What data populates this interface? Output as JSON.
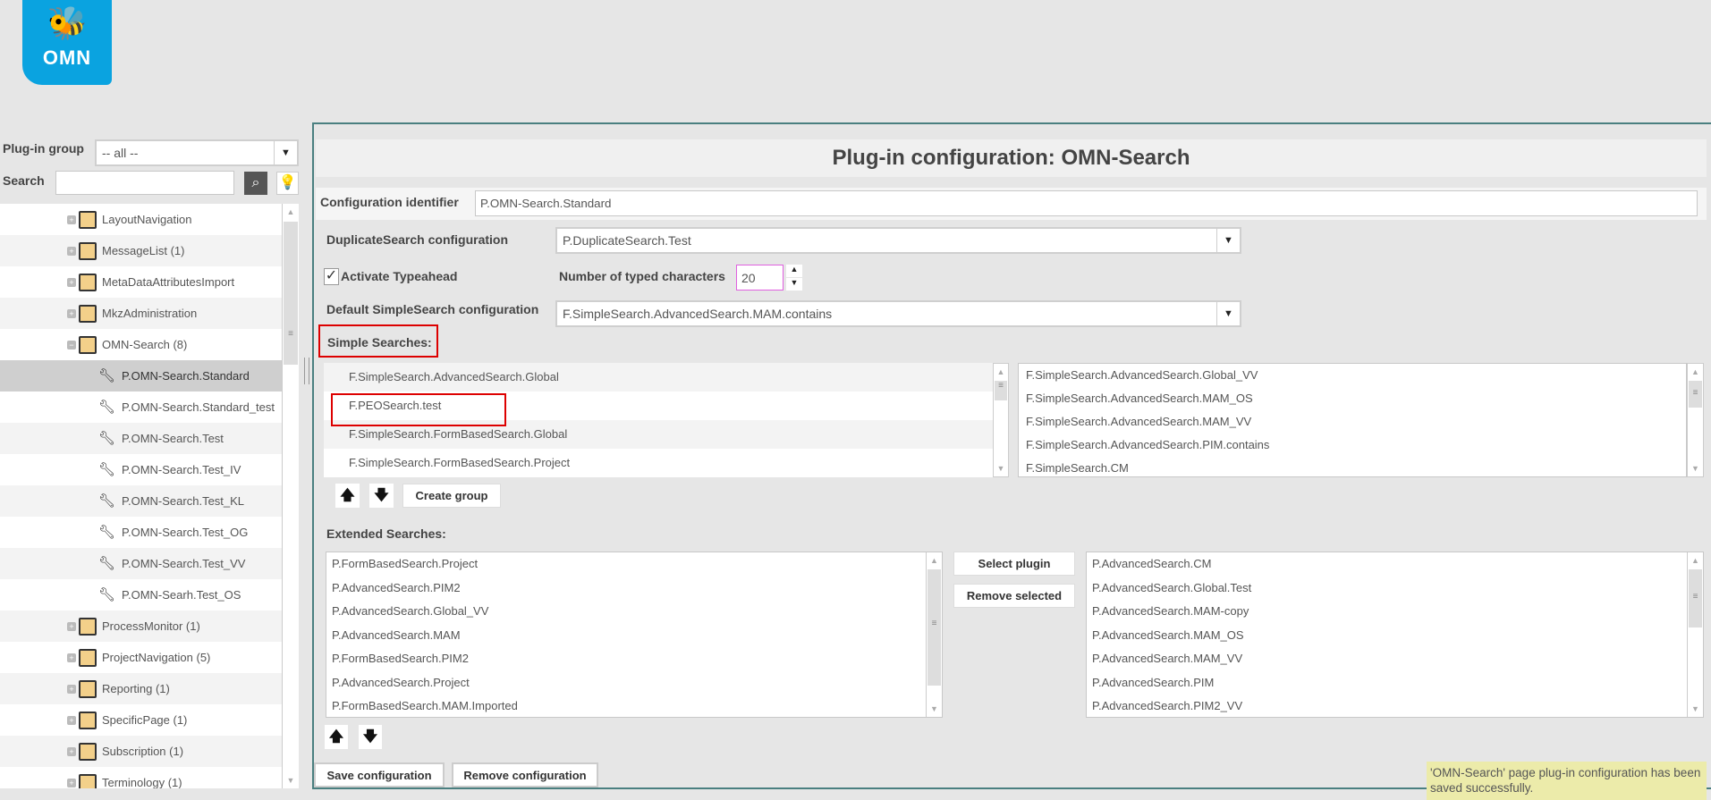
{
  "logo": {
    "text": "OMN"
  },
  "sidebar": {
    "plugin_group_label": "Plug-in group",
    "plugin_group_value": "-- all --",
    "search_label": "Search",
    "search_value": "",
    "tree": [
      {
        "label": "LayoutNavigation",
        "type": "group"
      },
      {
        "label": "MessageList (1)",
        "type": "group"
      },
      {
        "label": "MetaDataAttributesImport",
        "type": "group"
      },
      {
        "label": "MkzAdministration",
        "type": "group"
      },
      {
        "label": "OMN-Search (8)",
        "type": "group",
        "expanded": true
      },
      {
        "label": "P.OMN-Search.Standard",
        "type": "child",
        "selected": true
      },
      {
        "label": "P.OMN-Search.Standard_test",
        "type": "child"
      },
      {
        "label": "P.OMN-Search.Test",
        "type": "child"
      },
      {
        "label": "P.OMN-Search.Test_IV",
        "type": "child"
      },
      {
        "label": "P.OMN-Search.Test_KL",
        "type": "child"
      },
      {
        "label": "P.OMN-Search.Test_OG",
        "type": "child"
      },
      {
        "label": "P.OMN-Search.Test_VV",
        "type": "child"
      },
      {
        "label": "P.OMN-Searh.Test_OS",
        "type": "child"
      },
      {
        "label": "ProcessMonitor (1)",
        "type": "group"
      },
      {
        "label": "ProjectNavigation (5)",
        "type": "group"
      },
      {
        "label": "Reporting (1)",
        "type": "group"
      },
      {
        "label": "SpecificPage (1)",
        "type": "group"
      },
      {
        "label": "Subscription (1)",
        "type": "group"
      },
      {
        "label": "Terminology (1)",
        "type": "group"
      }
    ]
  },
  "main": {
    "title": "Plug-in configuration: OMN-Search",
    "config_id_label": "Configuration identifier",
    "config_id_value": "P.OMN-Search.Standard",
    "duplicate_label": "DuplicateSearch configuration",
    "duplicate_value": "P.DuplicateSearch.Test",
    "typeahead_label": "Activate Typeahead",
    "typeahead_checked": true,
    "typed_chars_label": "Number of typed characters",
    "typed_chars_value": "20",
    "default_simple_label": "Default SimpleSearch configuration",
    "default_simple_value": "F.SimpleSearch.AdvancedSearch.MAM.contains",
    "simple_label": "Simple Searches:",
    "simple_selected": [
      "F.SimpleSearch.AdvancedSearch.Global",
      "F.PEOSearch.test",
      "F.SimpleSearch.FormBasedSearch.Global",
      "F.SimpleSearch.FormBasedSearch.Project"
    ],
    "simple_available": [
      "F.SimpleSearch.AdvancedSearch.Global_VV",
      "F.SimpleSearch.AdvancedSearch.MAM_OS",
      "F.SimpleSearch.AdvancedSearch.MAM_VV",
      "F.SimpleSearch.AdvancedSearch.PIM.contains",
      "F.SimpleSearch.CM"
    ],
    "create_group": "Create group",
    "extended_label": "Extended Searches:",
    "extended_selected": [
      "P.FormBasedSearch.Project",
      "P.AdvancedSearch.PIM2",
      "P.AdvancedSearch.Global_VV",
      "P.AdvancedSearch.MAM",
      "P.FormBasedSearch.PIM2",
      "P.AdvancedSearch.Project",
      "P.FormBasedSearch.MAM.Imported"
    ],
    "extended_available": [
      "P.AdvancedSearch.CM",
      "P.AdvancedSearch.Global.Test",
      "P.AdvancedSearch.MAM-copy",
      "P.AdvancedSearch.MAM_OS",
      "P.AdvancedSearch.MAM_VV",
      "P.AdvancedSearch.PIM",
      "P.AdvancedSearch.PIM2_VV"
    ],
    "select_plugin": "Select plugin",
    "remove_selected": "Remove selected",
    "save_config": "Save configuration",
    "remove_config": "Remove configuration",
    "message": "'OMN-Search' page plug-in configuration has been saved successfully."
  }
}
